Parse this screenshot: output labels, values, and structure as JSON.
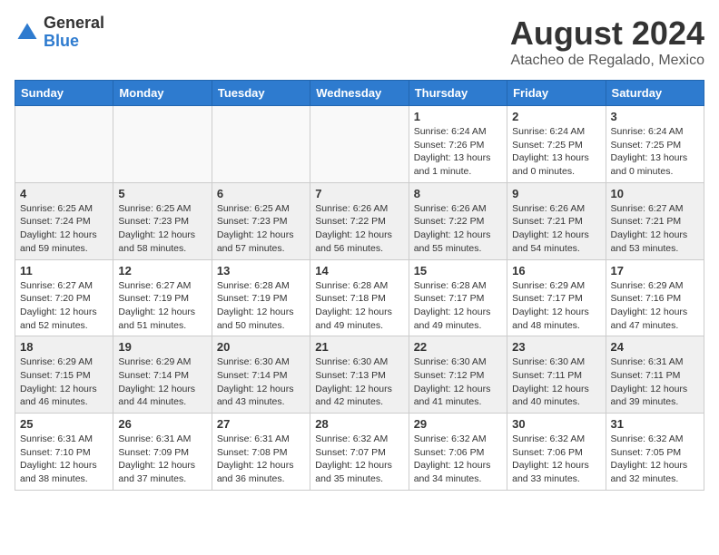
{
  "logo": {
    "general": "General",
    "blue": "Blue"
  },
  "header": {
    "title": "August 2024",
    "subtitle": "Atacheo de Regalado, Mexico"
  },
  "days": [
    "Sunday",
    "Monday",
    "Tuesday",
    "Wednesday",
    "Thursday",
    "Friday",
    "Saturday"
  ],
  "weeks": [
    [
      {
        "day": "",
        "text": ""
      },
      {
        "day": "",
        "text": ""
      },
      {
        "day": "",
        "text": ""
      },
      {
        "day": "",
        "text": ""
      },
      {
        "day": "1",
        "text": "Sunrise: 6:24 AM\nSunset: 7:26 PM\nDaylight: 13 hours\nand 1 minute."
      },
      {
        "day": "2",
        "text": "Sunrise: 6:24 AM\nSunset: 7:25 PM\nDaylight: 13 hours\nand 0 minutes."
      },
      {
        "day": "3",
        "text": "Sunrise: 6:24 AM\nSunset: 7:25 PM\nDaylight: 13 hours\nand 0 minutes."
      }
    ],
    [
      {
        "day": "4",
        "text": "Sunrise: 6:25 AM\nSunset: 7:24 PM\nDaylight: 12 hours\nand 59 minutes."
      },
      {
        "day": "5",
        "text": "Sunrise: 6:25 AM\nSunset: 7:23 PM\nDaylight: 12 hours\nand 58 minutes."
      },
      {
        "day": "6",
        "text": "Sunrise: 6:25 AM\nSunset: 7:23 PM\nDaylight: 12 hours\nand 57 minutes."
      },
      {
        "day": "7",
        "text": "Sunrise: 6:26 AM\nSunset: 7:22 PM\nDaylight: 12 hours\nand 56 minutes."
      },
      {
        "day": "8",
        "text": "Sunrise: 6:26 AM\nSunset: 7:22 PM\nDaylight: 12 hours\nand 55 minutes."
      },
      {
        "day": "9",
        "text": "Sunrise: 6:26 AM\nSunset: 7:21 PM\nDaylight: 12 hours\nand 54 minutes."
      },
      {
        "day": "10",
        "text": "Sunrise: 6:27 AM\nSunset: 7:21 PM\nDaylight: 12 hours\nand 53 minutes."
      }
    ],
    [
      {
        "day": "11",
        "text": "Sunrise: 6:27 AM\nSunset: 7:20 PM\nDaylight: 12 hours\nand 52 minutes."
      },
      {
        "day": "12",
        "text": "Sunrise: 6:27 AM\nSunset: 7:19 PM\nDaylight: 12 hours\nand 51 minutes."
      },
      {
        "day": "13",
        "text": "Sunrise: 6:28 AM\nSunset: 7:19 PM\nDaylight: 12 hours\nand 50 minutes."
      },
      {
        "day": "14",
        "text": "Sunrise: 6:28 AM\nSunset: 7:18 PM\nDaylight: 12 hours\nand 49 minutes."
      },
      {
        "day": "15",
        "text": "Sunrise: 6:28 AM\nSunset: 7:17 PM\nDaylight: 12 hours\nand 49 minutes."
      },
      {
        "day": "16",
        "text": "Sunrise: 6:29 AM\nSunset: 7:17 PM\nDaylight: 12 hours\nand 48 minutes."
      },
      {
        "day": "17",
        "text": "Sunrise: 6:29 AM\nSunset: 7:16 PM\nDaylight: 12 hours\nand 47 minutes."
      }
    ],
    [
      {
        "day": "18",
        "text": "Sunrise: 6:29 AM\nSunset: 7:15 PM\nDaylight: 12 hours\nand 46 minutes."
      },
      {
        "day": "19",
        "text": "Sunrise: 6:29 AM\nSunset: 7:14 PM\nDaylight: 12 hours\nand 44 minutes."
      },
      {
        "day": "20",
        "text": "Sunrise: 6:30 AM\nSunset: 7:14 PM\nDaylight: 12 hours\nand 43 minutes."
      },
      {
        "day": "21",
        "text": "Sunrise: 6:30 AM\nSunset: 7:13 PM\nDaylight: 12 hours\nand 42 minutes."
      },
      {
        "day": "22",
        "text": "Sunrise: 6:30 AM\nSunset: 7:12 PM\nDaylight: 12 hours\nand 41 minutes."
      },
      {
        "day": "23",
        "text": "Sunrise: 6:30 AM\nSunset: 7:11 PM\nDaylight: 12 hours\nand 40 minutes."
      },
      {
        "day": "24",
        "text": "Sunrise: 6:31 AM\nSunset: 7:11 PM\nDaylight: 12 hours\nand 39 minutes."
      }
    ],
    [
      {
        "day": "25",
        "text": "Sunrise: 6:31 AM\nSunset: 7:10 PM\nDaylight: 12 hours\nand 38 minutes."
      },
      {
        "day": "26",
        "text": "Sunrise: 6:31 AM\nSunset: 7:09 PM\nDaylight: 12 hours\nand 37 minutes."
      },
      {
        "day": "27",
        "text": "Sunrise: 6:31 AM\nSunset: 7:08 PM\nDaylight: 12 hours\nand 36 minutes."
      },
      {
        "day": "28",
        "text": "Sunrise: 6:32 AM\nSunset: 7:07 PM\nDaylight: 12 hours\nand 35 minutes."
      },
      {
        "day": "29",
        "text": "Sunrise: 6:32 AM\nSunset: 7:06 PM\nDaylight: 12 hours\nand 34 minutes."
      },
      {
        "day": "30",
        "text": "Sunrise: 6:32 AM\nSunset: 7:06 PM\nDaylight: 12 hours\nand 33 minutes."
      },
      {
        "day": "31",
        "text": "Sunrise: 6:32 AM\nSunset: 7:05 PM\nDaylight: 12 hours\nand 32 minutes."
      }
    ]
  ]
}
